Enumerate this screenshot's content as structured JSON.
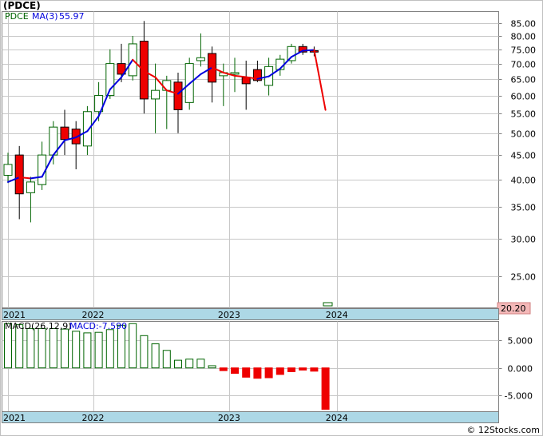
{
  "title": "(PDCE)",
  "footer": "© 12Stocks.com",
  "price_panel": {
    "legend_ticker": "PDCE",
    "legend_ma_label": "MA(3)",
    "legend_ma_value": "55.97",
    "last_price_label": "20.20"
  },
  "macd_panel": {
    "legend_label": "MACD(26,12,9)",
    "legend_value_label": "MACD:-7.590"
  },
  "colors": {
    "up_candle_stroke": "#006400",
    "down_candle_fill": "#ee0000",
    "ma_up": "#0000dd",
    "ma_down": "#ee0000",
    "axis_band": "#add8e6",
    "grid": "#c8c8c8",
    "macd_pos": "#006400",
    "macd_neg": "#ee0000",
    "last_price_bg": "#f4b8b8"
  },
  "chart_data": [
    {
      "type": "candlestick",
      "scale": "log",
      "ylim": [
        21.5,
        90
      ],
      "y_ticks": [
        25,
        30,
        35,
        40,
        45,
        50,
        55,
        60,
        65,
        70,
        75,
        80,
        85
      ],
      "y_tick_labels": [
        "25.00",
        "30.00",
        "35.00",
        "40.00",
        "45.00",
        "50.00",
        "55.00",
        "60.00",
        "65.00",
        "70.00",
        "75.00",
        "80.00",
        "85.00"
      ],
      "x_labels": [
        "2021",
        "2022",
        "2023",
        "2024"
      ],
      "x_label_positions": [
        0,
        7.5,
        19.5,
        29
      ],
      "grid": true,
      "candles": [
        {
          "o": 40.8,
          "h": 45.5,
          "l": 39.3,
          "c": 43.0
        },
        {
          "o": 45.0,
          "h": 47.0,
          "l": 33.0,
          "c": 37.3
        },
        {
          "o": 37.5,
          "h": 40.5,
          "l": 32.5,
          "c": 39.5
        },
        {
          "o": 39.0,
          "h": 48.0,
          "l": 38.0,
          "c": 45.0
        },
        {
          "o": 45.0,
          "h": 53.0,
          "l": 43.0,
          "c": 51.5
        },
        {
          "o": 51.5,
          "h": 56.0,
          "l": 45.0,
          "c": 48.5
        },
        {
          "o": 51.0,
          "h": 53.0,
          "l": 42.0,
          "c": 47.5
        },
        {
          "o": 47.0,
          "h": 57.0,
          "l": 45.0,
          "c": 55.5
        },
        {
          "o": 55.5,
          "h": 64.0,
          "l": 53.0,
          "c": 60.0
        },
        {
          "o": 60.0,
          "h": 75.0,
          "l": 59.0,
          "c": 70.0
        },
        {
          "o": 70.0,
          "h": 77.0,
          "l": 64.0,
          "c": 66.5
        },
        {
          "o": 66.0,
          "h": 80.0,
          "l": 64.5,
          "c": 77.0
        },
        {
          "o": 78.0,
          "h": 86.0,
          "l": 55.0,
          "c": 59.0
        },
        {
          "o": 59.0,
          "h": 70.0,
          "l": 50.0,
          "c": 61.5
        },
        {
          "o": 61.5,
          "h": 66.0,
          "l": 51.0,
          "c": 64.5
        },
        {
          "o": 64.0,
          "h": 67.0,
          "l": 50.0,
          "c": 56.0
        },
        {
          "o": 58.0,
          "h": 72.0,
          "l": 56.0,
          "c": 70.0
        },
        {
          "o": 71.0,
          "h": 81.0,
          "l": 69.0,
          "c": 72.0
        },
        {
          "o": 73.5,
          "h": 76.0,
          "l": 58.0,
          "c": 64.0
        },
        {
          "o": 66.0,
          "h": 70.0,
          "l": 57.0,
          "c": 67.0
        },
        {
          "o": 66.5,
          "h": 72.0,
          "l": 61.0,
          "c": 67.0
        },
        {
          "o": 65.5,
          "h": 71.0,
          "l": 56.0,
          "c": 63.5
        },
        {
          "o": 68.0,
          "h": 71.0,
          "l": 64.0,
          "c": 64.5
        },
        {
          "o": 63.0,
          "h": 72.0,
          "l": 60.0,
          "c": 69.0
        },
        {
          "o": 68.0,
          "h": 73.0,
          "l": 66.0,
          "c": 71.5
        },
        {
          "o": 71.0,
          "h": 77.0,
          "l": 70.0,
          "c": 76.0
        },
        {
          "o": 76.0,
          "h": 77.0,
          "l": 73.0,
          "c": 74.0
        },
        {
          "o": 74.5,
          "h": 76.0,
          "l": 72.5,
          "c": 74.0
        }
      ],
      "ma_series": {
        "name": "MA(3)",
        "values": [
          39.5,
          40.4,
          40.2,
          40.5,
          45.0,
          48.3,
          49.0,
          50.5,
          54.3,
          61.8,
          65.5,
          71.3,
          67.5,
          65.5,
          61.5,
          60.5,
          63.5,
          66.5,
          68.7,
          67.0,
          66.0,
          65.6,
          65.0,
          65.8,
          68.3,
          72.3,
          74.5,
          74.8,
          55.97
        ]
      },
      "last_price": 20.2
    },
    {
      "type": "bar",
      "name": "MACD(26,12,9)",
      "ylim": [
        -8.0,
        8.5
      ],
      "y_ticks": [
        5,
        0,
        -5
      ],
      "y_tick_labels": [
        "5.000",
        "0.000",
        "-5.000"
      ],
      "x_labels": [
        "2021",
        "2022",
        "2023",
        "2024"
      ],
      "values": [
        8.1,
        7.9,
        7.2,
        7.2,
        7.2,
        7.1,
        6.7,
        6.4,
        6.5,
        7.0,
        7.8,
        8.1,
        5.9,
        4.4,
        3.2,
        1.4,
        1.6,
        1.6,
        0.4,
        -0.5,
        -1.0,
        -1.7,
        -1.9,
        -1.8,
        -1.2,
        -0.7,
        -0.4,
        -0.6,
        -7.59
      ]
    }
  ]
}
